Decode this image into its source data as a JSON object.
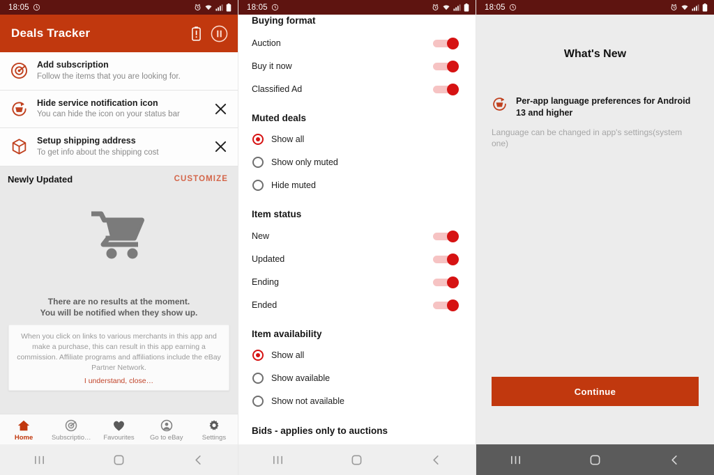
{
  "status_bar": {
    "time": "18:05",
    "icons": [
      "alarm-icon",
      "wifi-icon",
      "signal-icon",
      "battery-icon"
    ]
  },
  "colors": {
    "status_bar_bg": "#5e1410",
    "app_bar_bg": "#c1380e",
    "accent_red": "#c1380e",
    "toggle_on": "#d61212",
    "toggle_track": "#f6c3c3",
    "customize_link": "#d4664a",
    "page_bg": "#e9e9e9"
  },
  "screen1": {
    "app_bar": {
      "title": "Deals Tracker",
      "actions": [
        "battery-alert-icon",
        "pause-circle-icon"
      ]
    },
    "rows": [
      {
        "icon": "radar-target-icon",
        "title": "Add subscription",
        "subtitle": "Follow the items that you are looking for.",
        "dismissible": false
      },
      {
        "icon": "refresh-basket-icon",
        "title": "Hide service notification icon",
        "subtitle": "You can hide the icon on your status bar",
        "dismissible": true
      },
      {
        "icon": "package-box-icon",
        "title": "Setup shipping address",
        "subtitle": "To get info about the shipping cost",
        "dismissible": true
      }
    ],
    "section": {
      "title": "Newly Updated",
      "action": "CUSTOMIZE"
    },
    "empty_state": {
      "icon": "shopping-cart-icon",
      "line1": "There are no results at the moment.",
      "line2": "You will be notified when they show up."
    },
    "disclaimer": {
      "text": "When you click on links to various merchants in this app and make a purchase, this can result in this app earning a commission. Affiliate programs and affiliations include the eBay Partner Network.",
      "ack": "I understand, close…"
    },
    "tabs": [
      {
        "label": "Home",
        "icon": "home-icon",
        "active": true
      },
      {
        "label": "Subscriptio…",
        "icon": "radar-target-icon",
        "active": false
      },
      {
        "label": "Favourites",
        "icon": "heart-icon",
        "active": false
      },
      {
        "label": "Go to eBay",
        "icon": "account-circle-icon",
        "active": false
      },
      {
        "label": "Settings",
        "icon": "gear-icon",
        "active": false
      }
    ]
  },
  "screen2": {
    "groups": [
      {
        "title": "Buying format",
        "type": "switches",
        "items": [
          {
            "label": "Auction",
            "on": true
          },
          {
            "label": "Buy it now",
            "on": true
          },
          {
            "label": "Classified Ad",
            "on": true
          }
        ]
      },
      {
        "title": "Muted deals",
        "type": "radios",
        "items": [
          {
            "label": "Show all",
            "on": true
          },
          {
            "label": "Show only muted",
            "on": false
          },
          {
            "label": "Hide muted",
            "on": false
          }
        ]
      },
      {
        "title": "Item status",
        "type": "switches",
        "items": [
          {
            "label": "New",
            "on": true
          },
          {
            "label": "Updated",
            "on": true
          },
          {
            "label": "Ending",
            "on": true
          },
          {
            "label": "Ended",
            "on": true
          }
        ]
      },
      {
        "title": "Item availability",
        "type": "radios",
        "items": [
          {
            "label": "Show all",
            "on": true
          },
          {
            "label": "Show available",
            "on": false
          },
          {
            "label": "Show not available",
            "on": false
          }
        ]
      },
      {
        "title": "Bids - applies only to auctions",
        "type": "radios",
        "items": []
      }
    ]
  },
  "screen3": {
    "title": "What's New",
    "item": {
      "icon": "refresh-basket-icon",
      "heading": "Per-app language preferences for Android 13 and higher",
      "description": "Language can be changed in app's settings(system one)"
    },
    "continue_label": "Continue"
  },
  "nav": {
    "recents": "recents-icon",
    "home": "home-square-icon",
    "back": "back-chevron-icon"
  }
}
